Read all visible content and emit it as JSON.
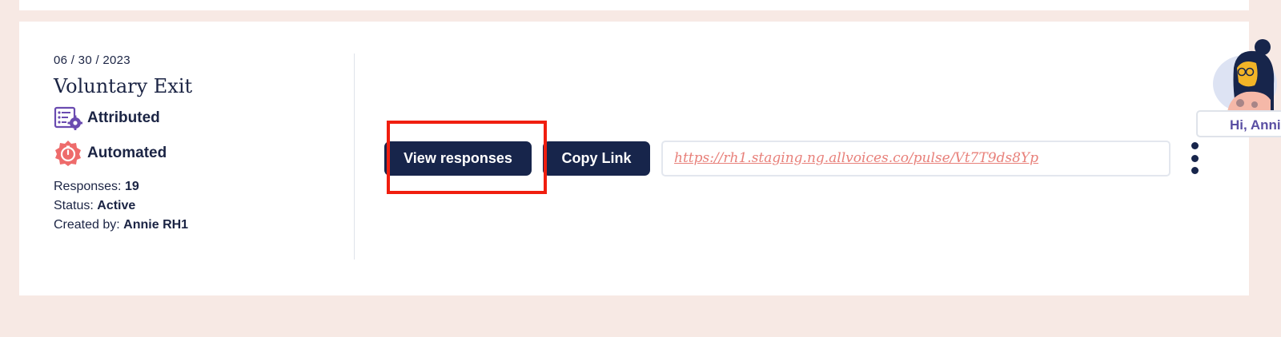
{
  "survey": {
    "date": "06 / 30 / 2023",
    "title": "Voluntary Exit",
    "tags": [
      {
        "label": "Attributed",
        "icon": "attributed-checklist-gear-icon"
      },
      {
        "label": "Automated",
        "icon": "automated-timer-icon"
      }
    ],
    "meta": {
      "responses_label": "Responses:",
      "responses_value": "19",
      "status_label": "Status:",
      "status_value": "Active",
      "created_label": "Created by:",
      "created_value": "Annie RH1"
    }
  },
  "actions": {
    "view_label": "View responses",
    "copy_label": "Copy Link",
    "link": "https://rh1.staging.ng.allvoices.co/pulse/Vt7T9ds8Yp"
  },
  "user": {
    "greeting": "Hi, Annie",
    "avatar": "user-avatar-illustration"
  },
  "colors": {
    "background": "#f7e9e4",
    "navy": "#17254b",
    "link": "#e8807a",
    "highlight": "#f01e0f",
    "accent_purple": "#6a4bb0"
  }
}
